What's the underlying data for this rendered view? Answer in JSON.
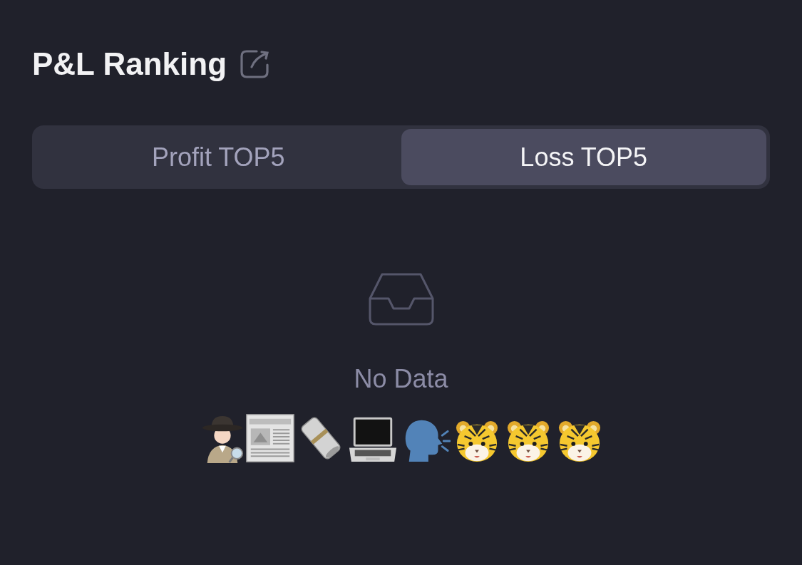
{
  "header": {
    "title": "P&L Ranking"
  },
  "tabs": [
    {
      "label": "Profit TOP5",
      "selected": false
    },
    {
      "label": "Loss TOP5",
      "selected": true
    }
  ],
  "empty_state": {
    "message": "No Data"
  }
}
